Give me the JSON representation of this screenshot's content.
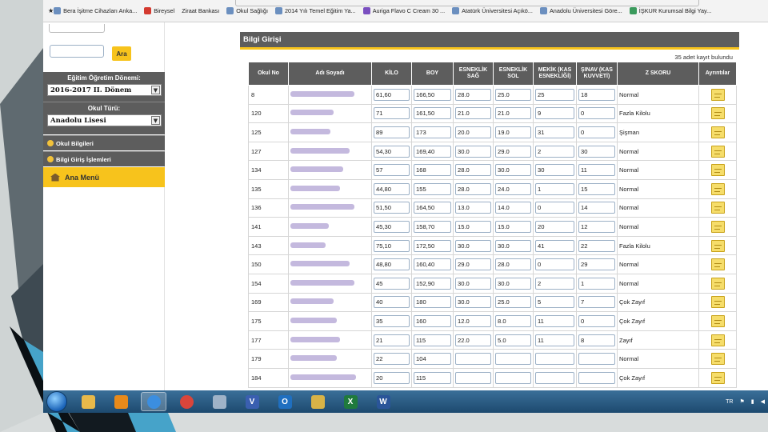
{
  "favorites": [
    {
      "label": "Bera İşitme Cihazları Anka..."
    },
    {
      "label": "Bireysel"
    },
    {
      "label": "Ziraat Bankası"
    },
    {
      "label": "Okul Sağlığı"
    },
    {
      "label": "2014 Yılı Temel Eğitim Ya..."
    },
    {
      "label": "Auriga Flavo C Cream 30 ..."
    },
    {
      "label": "Atatürk Üniversitesi Açıkö..."
    },
    {
      "label": "Anadolu Üniversitesi Göre..."
    },
    {
      "label": "İŞKUR Kurumsal Bilgi Yay..."
    }
  ],
  "sidebar": {
    "search_button": "Ara",
    "period_title": "Eğitim Öğretim Dönemi:",
    "period_value": "2016-2017 II. Dönem",
    "school_type_title": "Okul Türü:",
    "school_type_value": "Anadolu Lisesi",
    "items": [
      {
        "label": "Okul Bilgileri"
      },
      {
        "label": "Bilgi Giriş İşlemleri"
      }
    ],
    "main_menu": "Ana Menü"
  },
  "main": {
    "title": "Bilgi Girişi",
    "record_count": "35 adet kayıt bulundu",
    "columns": [
      "Okul No",
      "Adı Soyadı",
      "KİLO",
      "BOY",
      "ESNEKLİK SAĞ",
      "ESNEKLİK SOL",
      "MEKİK (KAS ESNEKLİĞİ)",
      "ŞINAV (KAS KUVVETİ)",
      "Z SKORU",
      "Ayrıntılar"
    ],
    "rows": [
      {
        "no": "8",
        "kilo": "61,60",
        "boy": "166,50",
        "sag": "28.0",
        "sol": "25.0",
        "mekik": "25",
        "sinav": "18",
        "z": "Normal"
      },
      {
        "no": "120",
        "kilo": "71",
        "boy": "161,50",
        "sag": "21.0",
        "sol": "21.0",
        "mekik": "9",
        "sinav": "0",
        "z": "Fazla Kilolu"
      },
      {
        "no": "125",
        "kilo": "89",
        "boy": "173",
        "sag": "20.0",
        "sol": "19.0",
        "mekik": "31",
        "sinav": "0",
        "z": "Şişman"
      },
      {
        "no": "127",
        "kilo": "54,30",
        "boy": "169,40",
        "sag": "30.0",
        "sol": "29.0",
        "mekik": "2",
        "sinav": "30",
        "z": "Normal"
      },
      {
        "no": "134",
        "kilo": "57",
        "boy": "168",
        "sag": "28.0",
        "sol": "30.0",
        "mekik": "30",
        "sinav": "11",
        "z": "Normal"
      },
      {
        "no": "135",
        "kilo": "44,80",
        "boy": "155",
        "sag": "28.0",
        "sol": "24.0",
        "mekik": "1",
        "sinav": "15",
        "z": "Normal"
      },
      {
        "no": "136",
        "kilo": "51,50",
        "boy": "164,50",
        "sag": "13.0",
        "sol": "14.0",
        "mekik": "0",
        "sinav": "14",
        "z": "Normal"
      },
      {
        "no": "141",
        "kilo": "45,30",
        "boy": "158,70",
        "sag": "15.0",
        "sol": "15.0",
        "mekik": "20",
        "sinav": "12",
        "z": "Normal"
      },
      {
        "no": "143",
        "kilo": "75,10",
        "boy": "172,50",
        "sag": "30.0",
        "sol": "30.0",
        "mekik": "41",
        "sinav": "22",
        "z": "Fazla Kilolu"
      },
      {
        "no": "150",
        "kilo": "48,80",
        "boy": "160,40",
        "sag": "29.0",
        "sol": "28.0",
        "mekik": "0",
        "sinav": "29",
        "z": "Normal"
      },
      {
        "no": "154",
        "kilo": "45",
        "boy": "152,90",
        "sag": "30.0",
        "sol": "30.0",
        "mekik": "2",
        "sinav": "1",
        "z": "Normal"
      },
      {
        "no": "169",
        "kilo": "40",
        "boy": "180",
        "sag": "30.0",
        "sol": "25.0",
        "mekik": "5",
        "sinav": "7",
        "z": "Çok Zayıf"
      },
      {
        "no": "175",
        "kilo": "35",
        "boy": "160",
        "sag": "12.0",
        "sol": "8.0",
        "mekik": "11",
        "sinav": "0",
        "z": "Çok Zayıf"
      },
      {
        "no": "177",
        "kilo": "21",
        "boy": "115",
        "sag": "22.0",
        "sol": "5.0",
        "mekik": "11",
        "sinav": "8",
        "z": "Zayıf"
      },
      {
        "no": "179",
        "kilo": "22",
        "boy": "104",
        "sag": "",
        "sol": "",
        "mekik": "",
        "sinav": "",
        "z": "Normal"
      },
      {
        "no": "184",
        "kilo": "20",
        "boy": "115",
        "sag": "",
        "sol": "",
        "mekik": "",
        "sinav": "",
        "z": "Çok Zayıf"
      }
    ]
  },
  "taskbar": {
    "apps": [
      {
        "icon": "file-explorer-icon",
        "color": "#e8b94a"
      },
      {
        "icon": "media-player-icon",
        "color": "#e88a1a"
      },
      {
        "icon": "internet-explorer-icon",
        "color": "#3b8ee0"
      },
      {
        "icon": "chrome-icon",
        "color": "#d9453b"
      },
      {
        "icon": "document-icon",
        "color": "#9fb3c8"
      },
      {
        "icon": "visio-icon",
        "color": "#3a5fb0",
        "glyph": "V"
      },
      {
        "icon": "outlook-icon",
        "color": "#1f6fc0",
        "glyph": "O"
      },
      {
        "icon": "folder-icon",
        "color": "#d8b347"
      },
      {
        "icon": "excel-icon",
        "color": "#1f7a3c",
        "glyph": "X"
      },
      {
        "icon": "word-icon",
        "color": "#2a5599",
        "glyph": "W"
      }
    ],
    "language": "TR"
  }
}
